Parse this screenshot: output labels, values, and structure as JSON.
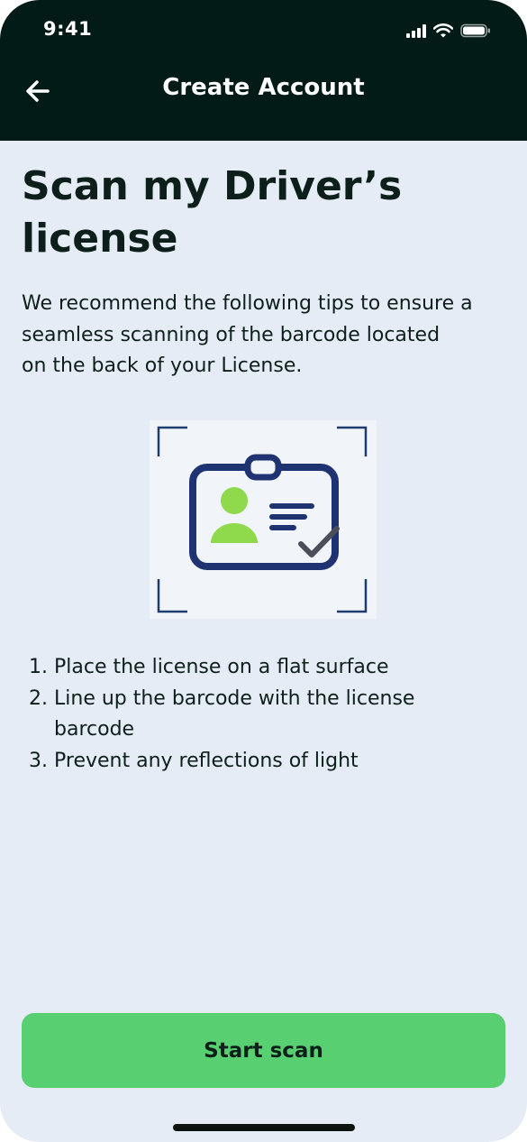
{
  "status_bar": {
    "time": "9:41"
  },
  "header": {
    "title": "Create Account",
    "back_icon": "arrow-left-icon"
  },
  "main": {
    "title_line1": "Scan my Driver’s",
    "title_line2": "license",
    "intro_line1": "We recommend the following tips to ensure a",
    "intro_line2": "seamless scanning of the barcode located",
    "intro_line3": "on the back of your License.",
    "illustration_icon": "id-card-check-icon"
  },
  "tips": [
    {
      "num": "1.",
      "text": "Place the license on a flat surface"
    },
    {
      "num": "2.",
      "text": "Line up the barcode with the license barcode"
    },
    {
      "num": "3.",
      "text": "Prevent any reflections of light"
    }
  ],
  "footer": {
    "start_button": "Start scan"
  },
  "colors": {
    "header_bg": "#021b17",
    "page_bg": "#e5ecf5",
    "accent_green": "#58cf71",
    "icon_navy": "#1f3373",
    "person_green": "#8fd94c"
  }
}
